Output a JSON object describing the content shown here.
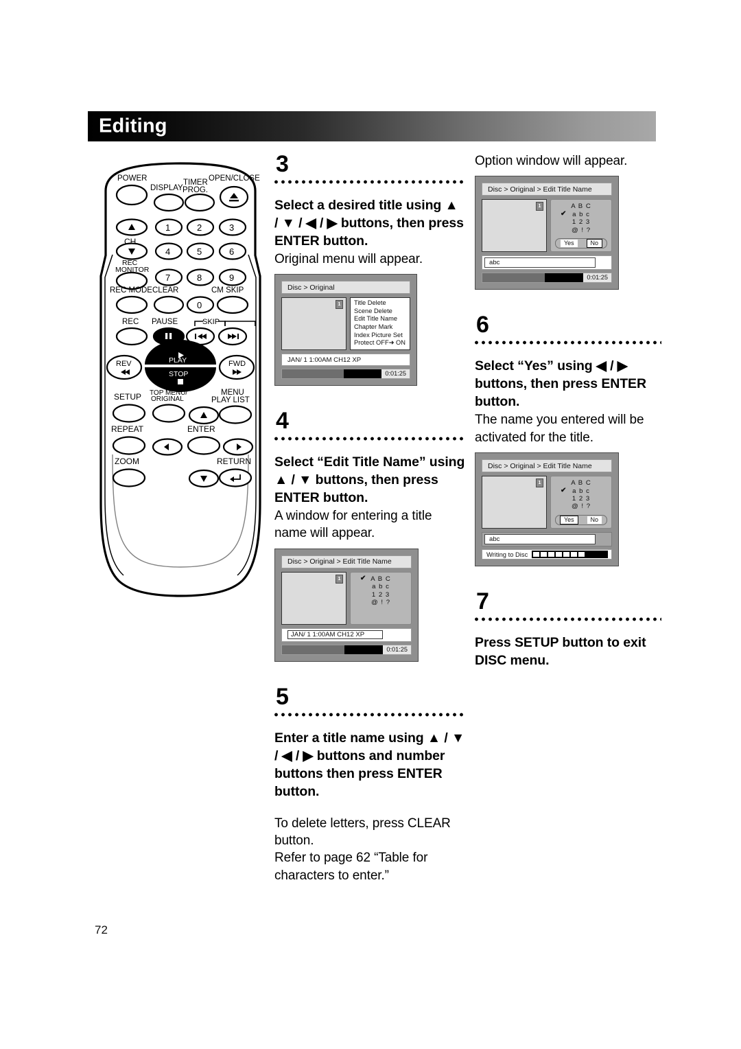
{
  "header": {
    "title": "Editing"
  },
  "page_number": "72",
  "remote": {
    "labels": {
      "power": "POWER",
      "display": "DISPLAY",
      "timer_prog_1": "TIMER",
      "timer_prog_2": "PROG.",
      "open_close": "OPEN/CLOSE",
      "ch": "CH",
      "rec_monitor_1": "REC",
      "rec_monitor_2": "MONITOR",
      "rec_mode": "REC MODE",
      "clear": "CLEAR",
      "cm_skip": "CM SKIP",
      "rec": "REC",
      "pause": "PAUSE",
      "skip": "SKIP",
      "rev": "REV",
      "fwd": "FWD",
      "play": "PLAY",
      "stop": "STOP",
      "setup": "SETUP",
      "top_menu_1": "TOP MENU/",
      "top_menu_2": "ORIGINAL",
      "menu_1": "MENU",
      "menu_2": "PLAY LIST",
      "repeat": "REPEAT",
      "enter": "ENTER",
      "zoom": "ZOOM",
      "return": "RETURN"
    },
    "numbers": [
      "1",
      "2",
      "3",
      "4",
      "5",
      "6",
      "7",
      "8",
      "9",
      "0"
    ]
  },
  "steps": {
    "s3": {
      "number": "3",
      "bold": "Select a desired title using ▲ / ▼ / ◀ / ▶ buttons, then press ENTER button.",
      "note": "Original menu will appear."
    },
    "s4": {
      "number": "4",
      "bold": "Select “Edit Title Name” using ▲ / ▼ buttons, then press ENTER button.",
      "note": "A window for entering a title name will appear."
    },
    "s5": {
      "number": "5",
      "bold": "Enter a title name using ▲ / ▼ / ◀ / ▶ buttons and number buttons then press ENTER button.",
      "note1": "To delete letters, press CLEAR button.",
      "note2": "Refer to page 62 “Table for characters to enter.”"
    },
    "s6": {
      "number": "6",
      "bold": "Select “Yes” using ◀ / ▶ buttons, then press ENTER button.",
      "note": "The name you entered will be activated for the title."
    },
    "s7": {
      "number": "7",
      "bold": "Press SETUP button to exit DISC menu."
    },
    "option_intro": "Option window will appear."
  },
  "screens": {
    "original": {
      "breadcrumb": "Disc > Original",
      "badge": "1",
      "menu_items": [
        "Title Delete",
        "Scene Delete",
        "Edit Title Name",
        "Chapter Mark",
        "Index Picture Set",
        "Protect OFF➜ ON"
      ],
      "selected_index": 0,
      "info": "JAN/ 1   1:00AM  CH12     XP",
      "time": "0:01:25"
    },
    "edit_title_name": {
      "breadcrumb": "Disc > Original > Edit Title Name",
      "badge": "1",
      "charset_rows": [
        "A B C",
        "a b c",
        "1 2 3",
        "@ ! ?"
      ],
      "checked_index": 0,
      "info": "JAN/ 1   1:00AM  CH12  XP",
      "time": "0:01:25"
    },
    "option_window": {
      "breadcrumb": "Disc > Original > Edit Title Name",
      "badge": "1",
      "charset_rows": [
        "A B C",
        "a b c",
        "1 2 3",
        "@ ! ?"
      ],
      "checked_index": 1,
      "yes_label": "Yes",
      "no_label": "No",
      "selected_button": "No",
      "input_value": "abc",
      "time": "0:01:25"
    },
    "writing": {
      "breadcrumb": "Disc > Original > Edit Title Name",
      "badge": "1",
      "charset_rows": [
        "A B C",
        "a b c",
        "1 2 3",
        "@ ! ?"
      ],
      "checked_index": 1,
      "yes_label": "Yes",
      "no_label": "No",
      "selected_button": "Yes",
      "input_value": "abc",
      "status": "Writing to Disc"
    }
  },
  "colors": {
    "header_dark": "#000000",
    "header_light": "#a8a8a8",
    "tv_bezel": "#8f8f8f",
    "tv_panel": "#b7b7b7"
  }
}
